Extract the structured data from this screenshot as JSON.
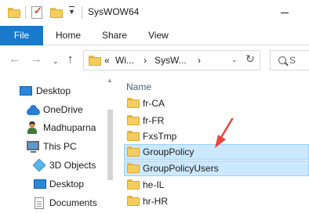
{
  "titlebar": {
    "title": "SysWOW64"
  },
  "ribbon": {
    "tabs": [
      "File",
      "Home",
      "Share",
      "View"
    ]
  },
  "address": {
    "overflow": "«",
    "crumbs": [
      "Wi...",
      "SysW..."
    ],
    "crumb_separator": "›",
    "search_glyph": "S"
  },
  "nav_pane": {
    "items": [
      {
        "label": "Desktop",
        "icon": "desktop-icon"
      },
      {
        "label": "OneDrive",
        "icon": "onedrive-cloud-icon"
      },
      {
        "label": "Madhuparna",
        "icon": "user-icon"
      },
      {
        "label": "This PC",
        "icon": "this-pc-icon"
      },
      {
        "label": "3D Objects",
        "icon": "3d-objects-icon"
      },
      {
        "label": "Desktop",
        "icon": "desktop-icon"
      },
      {
        "label": "Documents",
        "icon": "documents-icon"
      }
    ]
  },
  "content": {
    "column_header": "Name",
    "items": [
      {
        "name": "fr-CA",
        "selected": false
      },
      {
        "name": "fr-FR",
        "selected": false
      },
      {
        "name": "FxsTmp",
        "selected": false
      },
      {
        "name": "GroupPolicy",
        "selected": true
      },
      {
        "name": "GroupPolicyUsers",
        "selected": true
      },
      {
        "name": "he-IL",
        "selected": false
      },
      {
        "name": "hr-HR",
        "selected": false
      }
    ]
  },
  "colors": {
    "file_tab": "#1979ca",
    "selection_bg": "#cce8ff",
    "selection_border": "#99d1ff",
    "annotation_arrow": "#e8453c",
    "folder": "#f5cd5c"
  }
}
